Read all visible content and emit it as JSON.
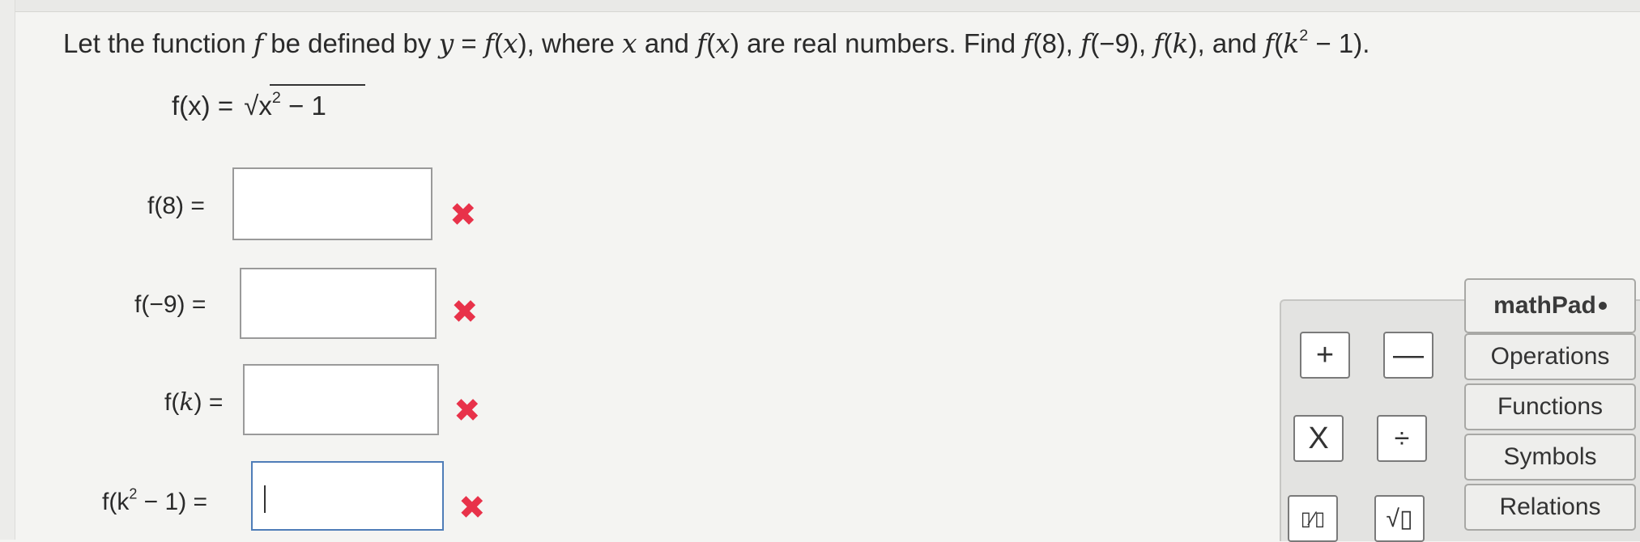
{
  "question": {
    "prefix": "Let the function ",
    "var_f": "f",
    "part2": " be defined by ",
    "var_y": "y",
    "part3": " = ",
    "fx1": "f",
    "part4": "(",
    "var_x1": "x",
    "part5": "), where ",
    "var_x2": "x",
    "part6": " and ",
    "fx2": "f",
    "part7": "(",
    "var_x3": "x",
    "part8": ") are real numbers. Find ",
    "f8": "f",
    "part9": "(8), ",
    "fm9": "f",
    "part10": "(−9), ",
    "fk": "f",
    "part11": "(",
    "var_k": "k",
    "part12": "), and ",
    "fk2": "f",
    "part13": "(",
    "var_k2": "k",
    "sup2": "2",
    "part14": " − 1)."
  },
  "function_def": {
    "left": "f(x) = ",
    "radical_sign": "√",
    "radicand_base": "x",
    "radicand_exp": "2",
    "radicand_rest": " − 1"
  },
  "rows": [
    {
      "label": "f(8) =",
      "value": "",
      "status": "✖"
    },
    {
      "label": "f(−9) =",
      "value": "",
      "status": "✖"
    },
    {
      "label_pre": "f(",
      "label_var": "k",
      "label_post": ") =",
      "value": "",
      "status": "✖"
    },
    {
      "label_pre": "f(k",
      "label_exp": "2",
      "label_post": " − 1) =",
      "value": "",
      "status": "✖"
    }
  ],
  "keypad": {
    "keys": [
      {
        "label": "+",
        "name": "plus-key"
      },
      {
        "label": "—",
        "name": "minus-key"
      },
      {
        "label": "X",
        "name": "multiply-key"
      },
      {
        "label": "÷",
        "name": "divide-key"
      },
      {
        "label": "▯⁄▯",
        "name": "fraction-key"
      },
      {
        "label": "√▯",
        "name": "sqrt-key"
      }
    ]
  },
  "mathpad": {
    "brand_bold": "math",
    "brand_rest": "Pad",
    "tabs": [
      "Operations",
      "Functions",
      "Symbols",
      "Relations"
    ]
  },
  "colors": {
    "error": "#e8324a",
    "active_border": "#4f7db8"
  }
}
